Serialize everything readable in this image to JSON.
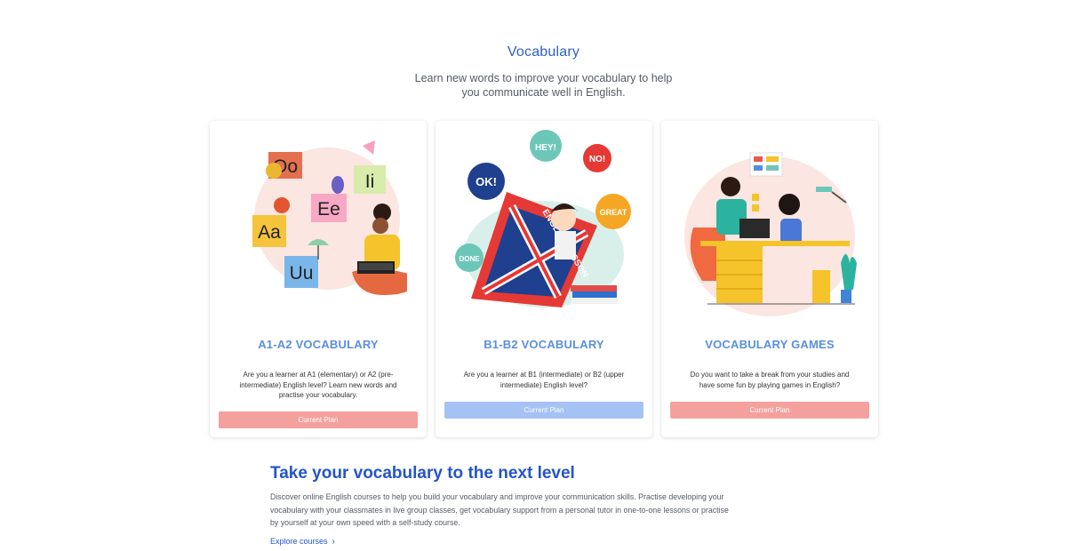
{
  "header": {
    "title": "Vocabulary",
    "subtitle": "Learn new words to improve your vocabulary to help you communicate well in English."
  },
  "cards": [
    {
      "title": "A1-A2 VOCABULARY",
      "description": "Are you a learner at A1 (elementary) or A2 (pre-intermediate) English level? Learn new words and practise your vocabulary.",
      "button_label": "Current Plan",
      "title_color": "#5b8fdf",
      "button_color": "#f4a19e",
      "illustration": "learner-with-letters",
      "illustration_text": [
        "Oo",
        "Ii",
        "Ee",
        "Aa",
        "Uu"
      ]
    },
    {
      "title": "B1-B2 VOCABULARY",
      "description": "Are you a learner at B1 (intermediate) or B2 (upper intermediate) English level?",
      "button_label": "Current Plan",
      "title_color": "#5b8fdf",
      "button_color": "#a4c2f4",
      "illustration": "english-lesson-book",
      "illustration_text": [
        "HEY!",
        "NO!",
        "OK!",
        "GREAT",
        "DONE",
        "ENGLISH LESSON"
      ]
    },
    {
      "title": "VOCABULARY GAMES",
      "description": "Do you want to take a break from your studies and have some fun by playing games in English?",
      "button_label": "Current Plan",
      "title_color": "#5b8fdf",
      "button_color": "#f4a19e",
      "illustration": "parent-and-child-at-desk",
      "illustration_text": []
    }
  ],
  "promo": {
    "title": "Take your vocabulary to the next level",
    "text": "Discover online English courses to help you build your vocabulary and improve your communication skills. Practise developing your vocabulary with your classmates in live group classes, get vocabulary support from a personal tutor in one-to-one lessons or practise by yourself at your own speed with a self-study course.",
    "link_label": "Explore courses",
    "link_icon": "chevron-right-icon"
  }
}
